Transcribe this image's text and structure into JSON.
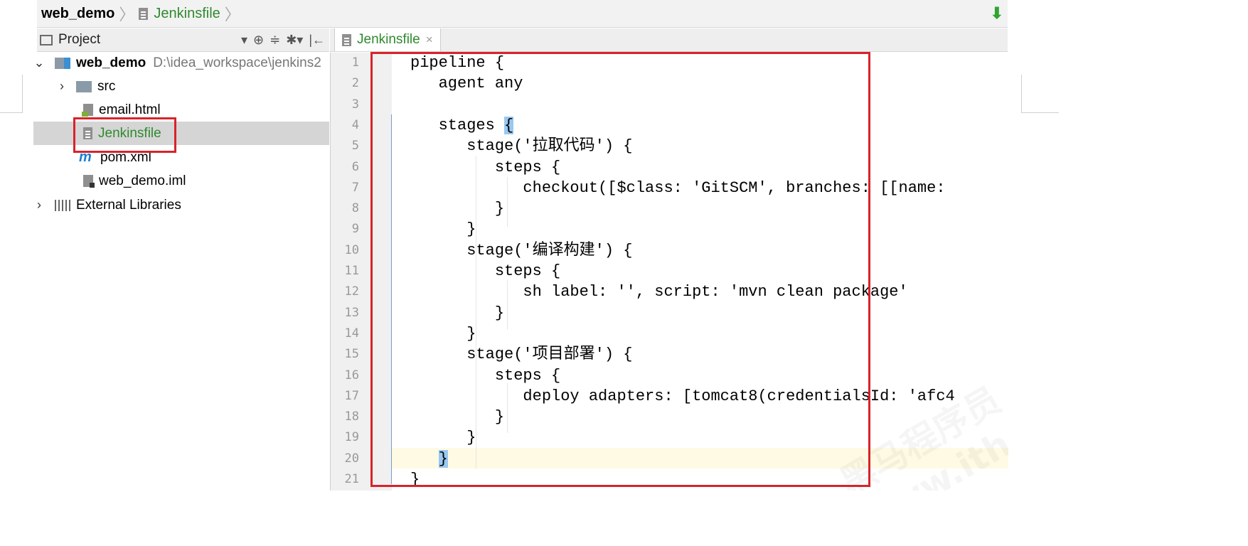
{
  "breadcrumb": {
    "project": "web_demo",
    "file": "Jenkinsfile"
  },
  "project_panel": {
    "title": "Project",
    "tools": [
      "▾",
      "⊕",
      "≑",
      "✱▾",
      "|←"
    ]
  },
  "tree": [
    {
      "label": "web_demo",
      "path": "D:\\idea_workspace\\jenkins2",
      "expanded": true
    },
    {
      "label": "src",
      "expanded": false
    },
    {
      "label": "email.html"
    },
    {
      "label": "Jenkinsfile",
      "selected": true
    },
    {
      "label": "pom.xml"
    },
    {
      "label": "web_demo.iml"
    },
    {
      "label": "External Libraries",
      "expanded": false
    }
  ],
  "editor": {
    "tab": "Jenkinsfile",
    "lines": [
      "pipeline {",
      "   agent any",
      "",
      "   stages {",
      "      stage('拉取代码') {",
      "         steps {",
      "            checkout([$class: 'GitSCM', branches: [[name:",
      "         }",
      "      }",
      "      stage('编译构建') {",
      "         steps {",
      "            sh label: '', script: 'mvn clean package'",
      "         }",
      "      }",
      "      stage('项目部署') {",
      "         steps {",
      "            deploy adapters: [tomcat8(credentialsId: 'afc4",
      "         }",
      "      }",
      "   }",
      "}"
    ],
    "line_numbers": [
      "1",
      "2",
      "3",
      "4",
      "5",
      "6",
      "7",
      "8",
      "9",
      "10",
      "11",
      "12",
      "13",
      "14",
      "15",
      "16",
      "17",
      "18",
      "19",
      "20",
      "21"
    ],
    "watermark": "黑马程序员 www.itheima.com"
  },
  "colors": {
    "annotation_red": "#d8232a",
    "file_green": "#2f8a2f",
    "selection": "#d5d5d5"
  }
}
